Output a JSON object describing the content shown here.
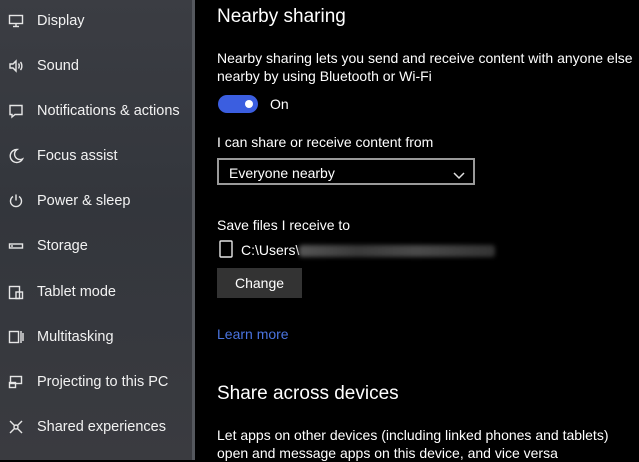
{
  "sidebar": {
    "items": [
      {
        "label": "Display",
        "icon": "monitor-icon"
      },
      {
        "label": "Sound",
        "icon": "speaker-icon"
      },
      {
        "label": "Notifications & actions",
        "icon": "notification-icon"
      },
      {
        "label": "Focus assist",
        "icon": "moon-icon"
      },
      {
        "label": "Power & sleep",
        "icon": "power-icon"
      },
      {
        "label": "Storage",
        "icon": "storage-icon"
      },
      {
        "label": "Tablet mode",
        "icon": "tablet-icon"
      },
      {
        "label": "Multitasking",
        "icon": "multitasking-icon"
      },
      {
        "label": "Projecting to this PC",
        "icon": "projecting-icon"
      },
      {
        "label": "Shared experiences",
        "icon": "shared-experiences-icon"
      }
    ]
  },
  "nearby": {
    "title": "Nearby sharing",
    "description": "Nearby sharing lets you send and receive content with anyone else nearby by using Bluetooth or Wi-Fi",
    "toggle_state": "On",
    "share_label": "I can share or receive content from",
    "share_value": "Everyone nearby",
    "save_label": "Save files I receive to",
    "save_path": "C:\\Users\\",
    "change_button": "Change",
    "learn_more": "Learn more"
  },
  "share_across": {
    "title": "Share across devices",
    "description": "Let apps on other devices (including linked phones and tablets) open and message apps on this device, and vice versa"
  },
  "colors": {
    "accent": "#3b5ee0",
    "link": "#4a74e0",
    "sidebar_bg": "#36393f",
    "content_bg": "#000000"
  }
}
